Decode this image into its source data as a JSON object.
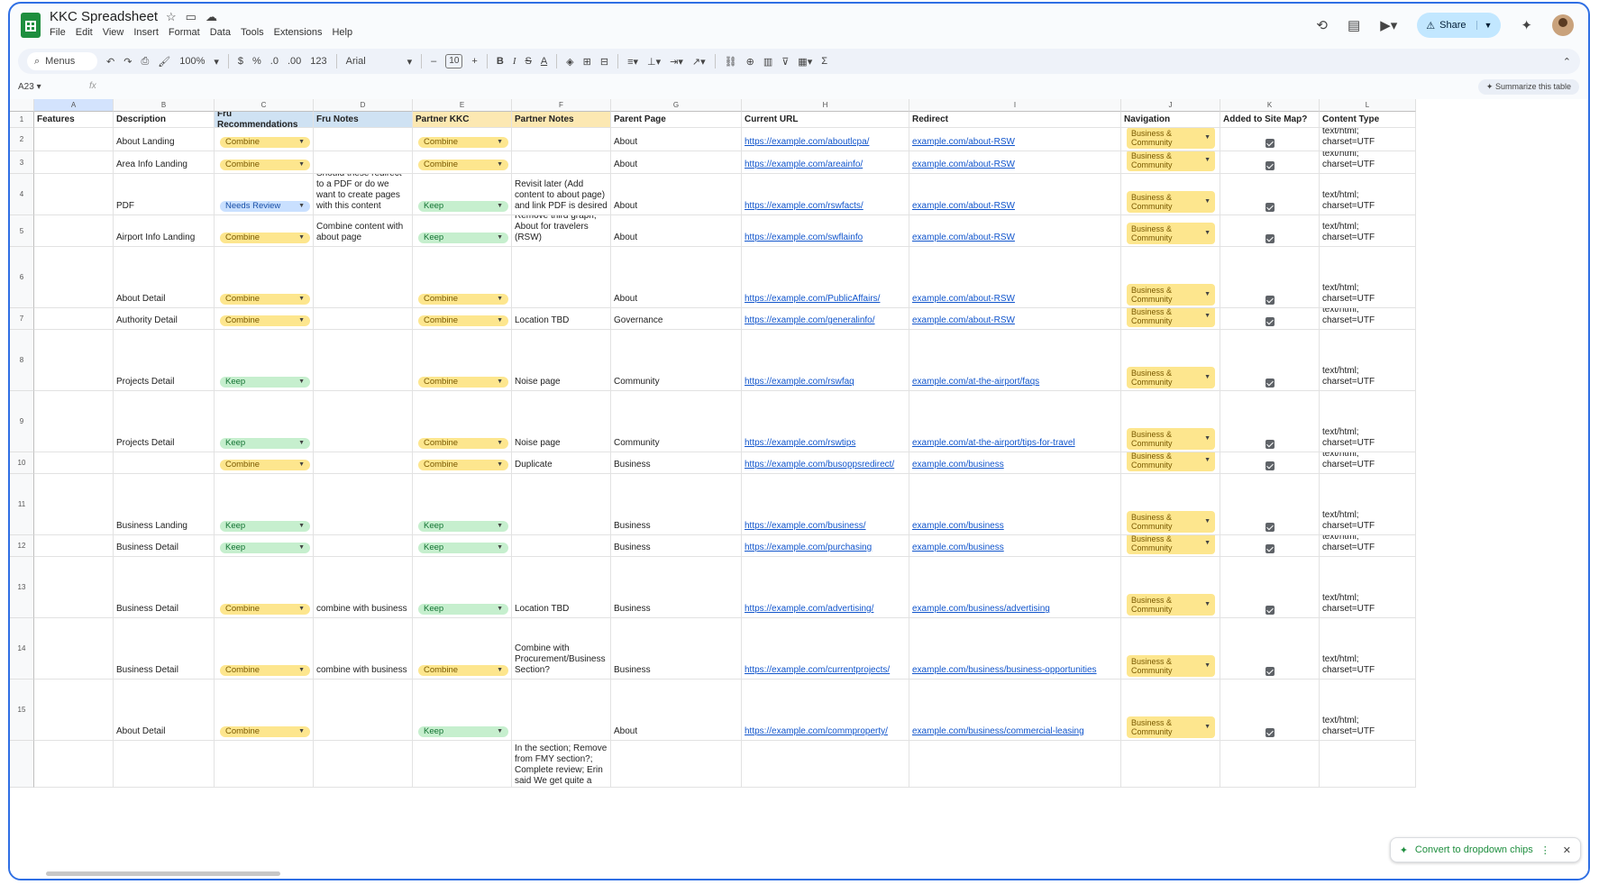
{
  "app": {
    "title": "KKC Spreadsheet",
    "menus": [
      "File",
      "Edit",
      "View",
      "Insert",
      "Format",
      "Data",
      "Tools",
      "Extensions",
      "Help"
    ],
    "share_label": "Share"
  },
  "toolbar": {
    "search_label": "Menus",
    "zoom": "100%",
    "currency": "$",
    "percent": "%",
    "dec_less": ".0",
    "dec_more": ".00",
    "num_format": "123",
    "font": "Arial",
    "font_size": "10",
    "minus": "–",
    "plus": "+",
    "bold": "B",
    "italic": "I",
    "strike": "S",
    "text_color": "A",
    "sigma": "Σ"
  },
  "formula_bar": {
    "name_box": "A23",
    "fx": "fx",
    "summarize_label": "Summarize this table"
  },
  "columns": [
    "A",
    "B",
    "C",
    "D",
    "E",
    "F",
    "G",
    "H",
    "I",
    "J",
    "K",
    "L"
  ],
  "headers": [
    "Features",
    "Description",
    "Fru Recommendations",
    "Fru Notes",
    "Partner KKC",
    "Partner Notes",
    "Parent Page",
    "Current URL",
    "Redirect",
    "Navigation",
    "Added to Site Map?",
    "Content Type"
  ],
  "header_colors": {
    "C": "#cfe2f3",
    "D": "#cfe2f3",
    "E": "#fce8b2",
    "F": "#fce8b2"
  },
  "rows": [
    {
      "n": "2",
      "desc": "About Landing",
      "fru": "Combine",
      "fru_notes": "",
      "partner": "Combine",
      "partner_notes": "",
      "parent": "About",
      "url": "https://example.com/aboutlcpa/",
      "redirect": "example.com/about-RSW",
      "nav": "Business & Community",
      "checked": true,
      "ctype": "text/html; charset=UTF"
    },
    {
      "n": "3",
      "desc": "Area Info Landing",
      "fru": "Combine",
      "fru_notes": "",
      "partner": "Combine",
      "partner_notes": "",
      "parent": "About",
      "url": "https://example.com/areainfo/",
      "redirect": "example.com/about-RSW",
      "nav": "Business & Community",
      "checked": true,
      "ctype": "text/html; charset=UTF"
    },
    {
      "n": "4",
      "desc": "PDF",
      "fru": "Needs Review",
      "fru_notes": "Should these redirect to a PDF or do we want to create pages with this content",
      "partner": "Keep",
      "partner_notes": "Revisit later (Add content to about page) and link PDF is desired",
      "parent": "About",
      "url": "https://example.com/rswfacts/",
      "redirect": "example.com/about-RSW",
      "nav": "Business & Community",
      "checked": true,
      "ctype": "text/html; charset=UTF"
    },
    {
      "n": "5",
      "desc": "Airport Info Landing",
      "fru": "Combine",
      "fru_notes": "Combine content with about page",
      "partner": "Keep",
      "partner_notes": "Keep for traveler side; Remove third graph; About for travelers (RSW)",
      "parent": "About",
      "url": "https://example.com/swflainfo",
      "redirect": "example.com/about-RSW",
      "nav": "Business & Community",
      "checked": true,
      "ctype": "text/html; charset=UTF"
    },
    {
      "n": "6",
      "desc": "About Detail",
      "fru": "Combine",
      "fru_notes": "",
      "partner": "Combine",
      "partner_notes": "",
      "parent": "About",
      "url": "https://example.com/PublicAffairs/",
      "redirect": "example.com/about-RSW",
      "nav": "Business & Community",
      "checked": true,
      "ctype": "text/html; charset=UTF"
    },
    {
      "n": "7",
      "desc": "Authority Detail",
      "fru": "Combine",
      "fru_notes": "",
      "partner": "Combine",
      "partner_notes": "Location TBD",
      "parent": "Governance",
      "url": "https://example.com/generalinfo/",
      "redirect": "example.com/about-RSW",
      "nav": "Business & Community",
      "checked": true,
      "ctype": "text/html; charset=UTF"
    },
    {
      "n": "8",
      "desc": "Projects Detail",
      "fru": "Keep",
      "fru_notes": "",
      "partner": "Combine",
      "partner_notes": "Noise page",
      "parent": "Community",
      "url": "https://example.com/rswfaq",
      "redirect": "example.com/at-the-airport/faqs",
      "nav": "Business & Community",
      "checked": true,
      "ctype": "text/html; charset=UTF"
    },
    {
      "n": "9",
      "desc": "Projects Detail",
      "fru": "Keep",
      "fru_notes": "",
      "partner": "Combine",
      "partner_notes": "Noise page",
      "parent": "Community",
      "url": "https://example.com/rswtips",
      "redirect": "example.com/at-the-airport/tips-for-travel",
      "nav": "Business & Community",
      "checked": true,
      "ctype": "text/html; charset=UTF"
    },
    {
      "n": "10",
      "desc": "",
      "fru": "Combine",
      "fru_notes": "",
      "partner": "Combine",
      "partner_notes": "Duplicate",
      "parent": "Business",
      "url": "https://example.com/busoppsredirect/",
      "redirect": "example.com/business",
      "nav": "Business & Community",
      "checked": true,
      "ctype": "text/html; charset=UTF"
    },
    {
      "n": "11",
      "desc": "Business Landing",
      "fru": "Keep",
      "fru_notes": "",
      "partner": "Keep",
      "partner_notes": "",
      "parent": "Business",
      "url": "https://example.com/business/",
      "redirect": "example.com/business",
      "nav": "Business & Community",
      "checked": true,
      "ctype": "text/html; charset=UTF"
    },
    {
      "n": "12",
      "desc": "Business Detail",
      "fru": "Keep",
      "fru_notes": "",
      "partner": "Keep",
      "partner_notes": "",
      "parent": "Business",
      "url": "https://example.com/purchasing",
      "redirect": "example.com/business",
      "nav": "Business & Community",
      "checked": true,
      "ctype": "text/html; charset=UTF"
    },
    {
      "n": "13",
      "desc": "Business Detail",
      "fru": "Combine",
      "fru_notes": "combine with business",
      "partner": "Keep",
      "partner_notes": "Location TBD",
      "parent": "Business",
      "url": "https://example.com/advertising/",
      "redirect": "example.com/business/advertising",
      "nav": "Business & Community",
      "checked": true,
      "ctype": "text/html; charset=UTF"
    },
    {
      "n": "14",
      "desc": "Business Detail",
      "fru": "Combine",
      "fru_notes": "combine with business",
      "partner": "Combine",
      "partner_notes": "Combine with Procurement/Business Section?",
      "parent": "Business",
      "url": "https://example.com/currentprojects/",
      "redirect": "example.com/business/business-opportunities",
      "nav": "Business & Community",
      "checked": true,
      "ctype": "text/html; charset=UTF"
    },
    {
      "n": "15",
      "desc": "About Detail",
      "fru": "Combine",
      "fru_notes": "",
      "partner": "Keep",
      "partner_notes": "",
      "parent": "About",
      "url": "https://example.com/commproperty/",
      "redirect": "example.com/business/commercial-leasing",
      "nav": "Business & Community",
      "checked": true,
      "ctype": "text/html; charset=UTF"
    },
    {
      "n": "",
      "desc": "",
      "fru": "",
      "fru_notes": "",
      "partner": "",
      "partner_notes": "In the section; Remove from FMY section?; Complete review; Erin said We get quite a few",
      "parent": "",
      "url": "",
      "redirect": "",
      "nav": "",
      "checked": false,
      "ctype": ""
    }
  ],
  "convert_chip": {
    "label": "Convert to dropdown chips"
  },
  "colors": {
    "accent": "#2f6fe4",
    "combine": "#fde68e",
    "keep": "#c6efce",
    "review": "#c9e0ff",
    "link": "#1155cc"
  }
}
